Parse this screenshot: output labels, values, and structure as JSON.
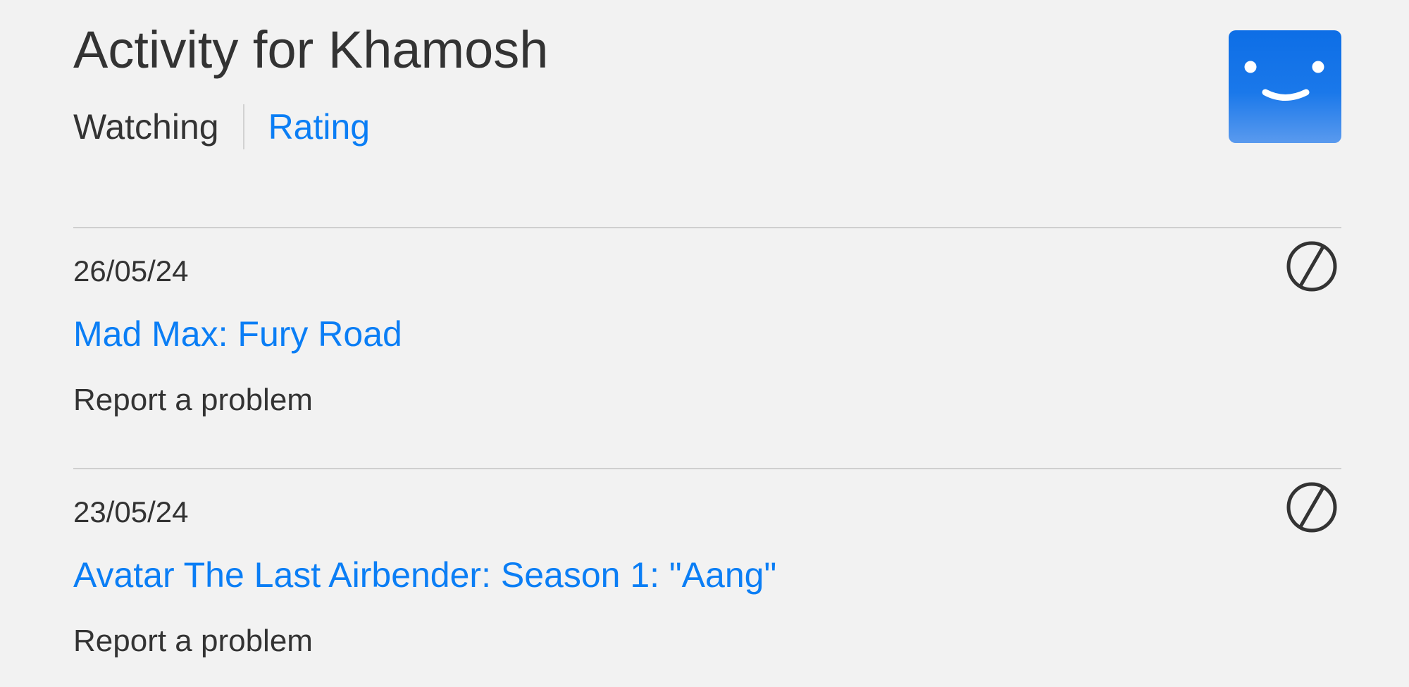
{
  "header": {
    "title": "Activity for Khamosh",
    "tabs": [
      {
        "label": "Watching",
        "active": false
      },
      {
        "label": "Rating",
        "active": true
      }
    ],
    "avatar_icon": "smiley-face-icon"
  },
  "colors": {
    "background": "#f2f2f2",
    "text": "#333333",
    "link": "#0b7ef5",
    "avatar": "#0d6ee6",
    "divider": "#cfcfcf"
  },
  "activity": [
    {
      "date": "26/05/24",
      "title": "Mad Max: Fury Road",
      "report_label": "Report a problem",
      "hide_icon": "hide-from-history-icon"
    },
    {
      "date": "23/05/24",
      "title": "Avatar The Last Airbender: Season 1: \"Aang\"",
      "report_label": "Report a problem",
      "hide_icon": "hide-from-history-icon"
    }
  ]
}
